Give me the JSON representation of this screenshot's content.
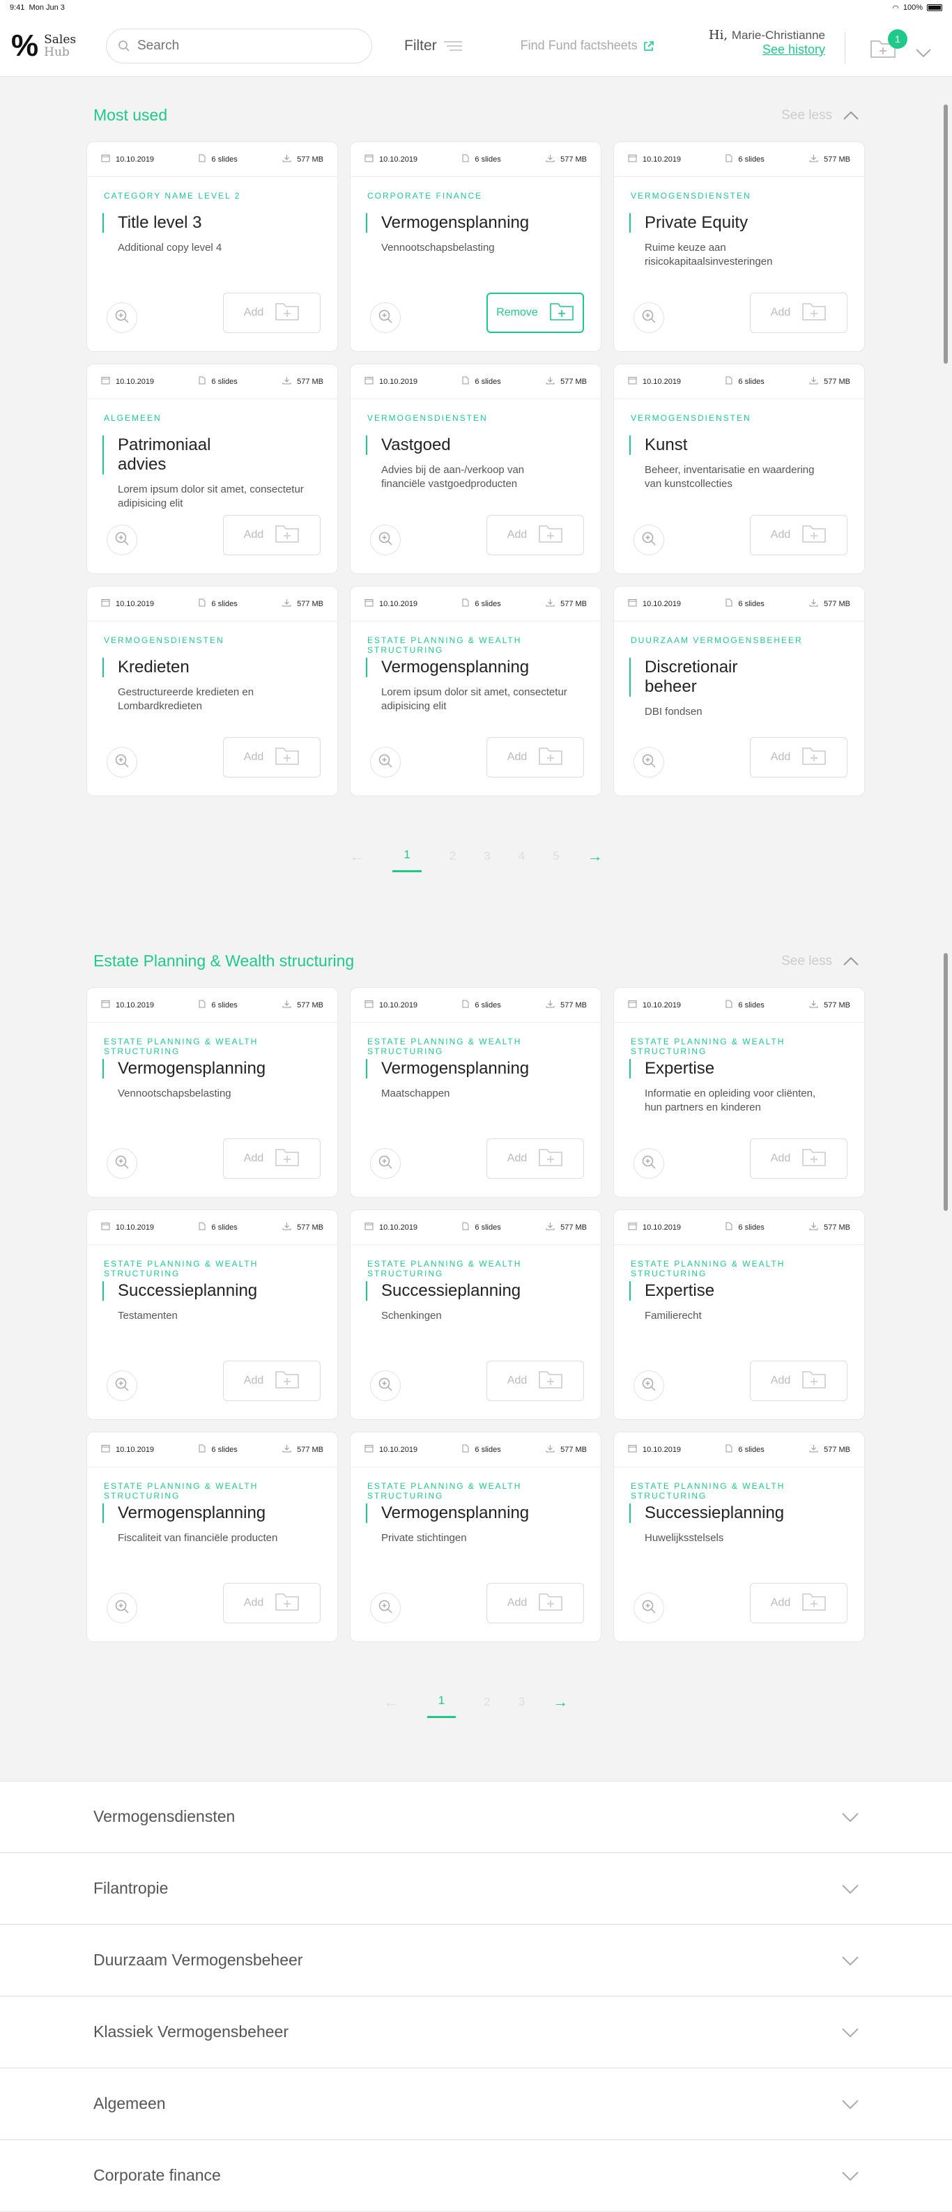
{
  "statusbar": {
    "time": "9:41",
    "date": "Mon Jun 3",
    "battery": "100%"
  },
  "brand": {
    "line1": "Sales",
    "line2": "Hub"
  },
  "search": {
    "placeholder": "Search"
  },
  "header": {
    "filter_label": "Filter",
    "fund_label": "Find Fund factsheets",
    "hi": "Hi,",
    "user_name": "Marie-Christianne",
    "history_label": "See history",
    "basket_count": "1"
  },
  "colors": {
    "accent": "#1fc98a",
    "background": "#f3f3f3"
  },
  "most_used": {
    "title": "Most used",
    "see_less": "See less",
    "cards": [
      {
        "date": "10.10.2019",
        "slides": "6 slides",
        "size": "577 MB",
        "category": "Category name level 2",
        "title": "Title level 3",
        "desc": "Additional copy level 4",
        "button": "Add",
        "active": false
      },
      {
        "date": "10.10.2019",
        "slides": "6 slides",
        "size": "577 MB",
        "category": "Corporate Finance",
        "title": "Vermogensplanning",
        "desc": "Vennootschapsbelasting",
        "button": "Remove",
        "active": true
      },
      {
        "date": "10.10.2019",
        "slides": "6 slides",
        "size": "577 MB",
        "category": "Vermogensdiensten",
        "title": "Private Equity",
        "desc": "Ruime keuze aan risicokapitaalsinvesteringen",
        "button": "Add",
        "active": false
      },
      {
        "date": "10.10.2019",
        "slides": "6 slides",
        "size": "577 MB",
        "category": "Algemeen",
        "title": "Patrimoniaal advies",
        "desc": "Lorem ipsum dolor sit amet, consectetur adipisicing elit",
        "button": "Add",
        "active": false
      },
      {
        "date": "10.10.2019",
        "slides": "6 slides",
        "size": "577 MB",
        "category": "Vermogensdiensten",
        "title": "Vastgoed",
        "desc": "Advies bij de aan-/verkoop van financiële vastgoedproducten",
        "button": "Add",
        "active": false
      },
      {
        "date": "10.10.2019",
        "slides": "6 slides",
        "size": "577 MB",
        "category": "Vermogensdiensten",
        "title": "Kunst",
        "desc": "Beheer, inventarisatie en waardering van kunstcollecties",
        "button": "Add",
        "active": false
      },
      {
        "date": "10.10.2019",
        "slides": "6 slides",
        "size": "577 MB",
        "category": "Vermogensdiensten",
        "title": "Kredieten",
        "desc": "Gestructureerde kredieten en Lombardkredieten",
        "button": "Add",
        "active": false
      },
      {
        "date": "10.10.2019",
        "slides": "6 slides",
        "size": "577 MB",
        "category": "Estate Planning & Wealth Structuring",
        "title": "Vermogensplanning",
        "desc": "Lorem ipsum dolor sit amet, consectetur adipisicing elit",
        "button": "Add",
        "active": false
      },
      {
        "date": "10.10.2019",
        "slides": "6 slides",
        "size": "577 MB",
        "category": "Duurzaam Vermogensbeheer",
        "title": "Discretionair beheer",
        "desc": "DBI fondsen",
        "button": "Add",
        "active": false
      }
    ],
    "pages": [
      "1",
      "2",
      "3",
      "4",
      "5"
    ],
    "prev": "←",
    "next": "→"
  },
  "estate": {
    "title": "Estate Planning & Wealth structuring",
    "see_less": "See less",
    "cards": [
      {
        "date": "10.10.2019",
        "slides": "6 slides",
        "size": "577 MB",
        "category": "Estate Planning & Wealth Structuring",
        "title": "Vermogensplanning",
        "desc": "Vennootschapsbelasting",
        "button": "Add",
        "active": false
      },
      {
        "date": "10.10.2019",
        "slides": "6 slides",
        "size": "577 MB",
        "category": "Estate Planning & Wealth Structuring",
        "title": "Vermogensplanning",
        "desc": "Maatschappen",
        "button": "Add",
        "active": false
      },
      {
        "date": "10.10.2019",
        "slides": "6 slides",
        "size": "577 MB",
        "category": "Estate Planning & Wealth Structuring",
        "title": "Expertise",
        "desc": "Informatie en opleiding voor cliënten, hun partners en kinderen",
        "button": "Add",
        "active": false
      },
      {
        "date": "10.10.2019",
        "slides": "6 slides",
        "size": "577 MB",
        "category": "Estate Planning & Wealth Structuring",
        "title": "Successieplanning",
        "desc": "Testamenten",
        "button": "Add",
        "active": false
      },
      {
        "date": "10.10.2019",
        "slides": "6 slides",
        "size": "577 MB",
        "category": "Estate Planning & Wealth Structuring",
        "title": "Successieplanning",
        "desc": "Schenkingen",
        "button": "Add",
        "active": false
      },
      {
        "date": "10.10.2019",
        "slides": "6 slides",
        "size": "577 MB",
        "category": "Estate Planning & Wealth Structuring",
        "title": "Expertise",
        "desc": "Familierecht",
        "button": "Add",
        "active": false
      },
      {
        "date": "10.10.2019",
        "slides": "6 slides",
        "size": "577 MB",
        "category": "Estate Planning & Wealth Structuring",
        "title": "Vermogensplanning",
        "desc": "Fiscaliteit van financiële producten",
        "button": "Add",
        "active": false
      },
      {
        "date": "10.10.2019",
        "slides": "6 slides",
        "size": "577 MB",
        "category": "Estate Planning & Wealth Structuring",
        "title": "Vermogensplanning",
        "desc": "Private stichtingen",
        "button": "Add",
        "active": false
      },
      {
        "date": "10.10.2019",
        "slides": "6 slides",
        "size": "577 MB",
        "category": "Estate Planning & Wealth Structuring",
        "title": "Successieplanning",
        "desc": "Huwelijksstelsels",
        "button": "Add",
        "active": false
      }
    ],
    "pages": [
      "1",
      "2",
      "3"
    ],
    "prev": "←",
    "next": "→"
  },
  "accordion": [
    "Vermogensdiensten",
    "Filantropie",
    "Duurzaam Vermogensbeheer",
    "Klassiek Vermogensbeheer",
    "Algemeen",
    "Corporate finance"
  ]
}
